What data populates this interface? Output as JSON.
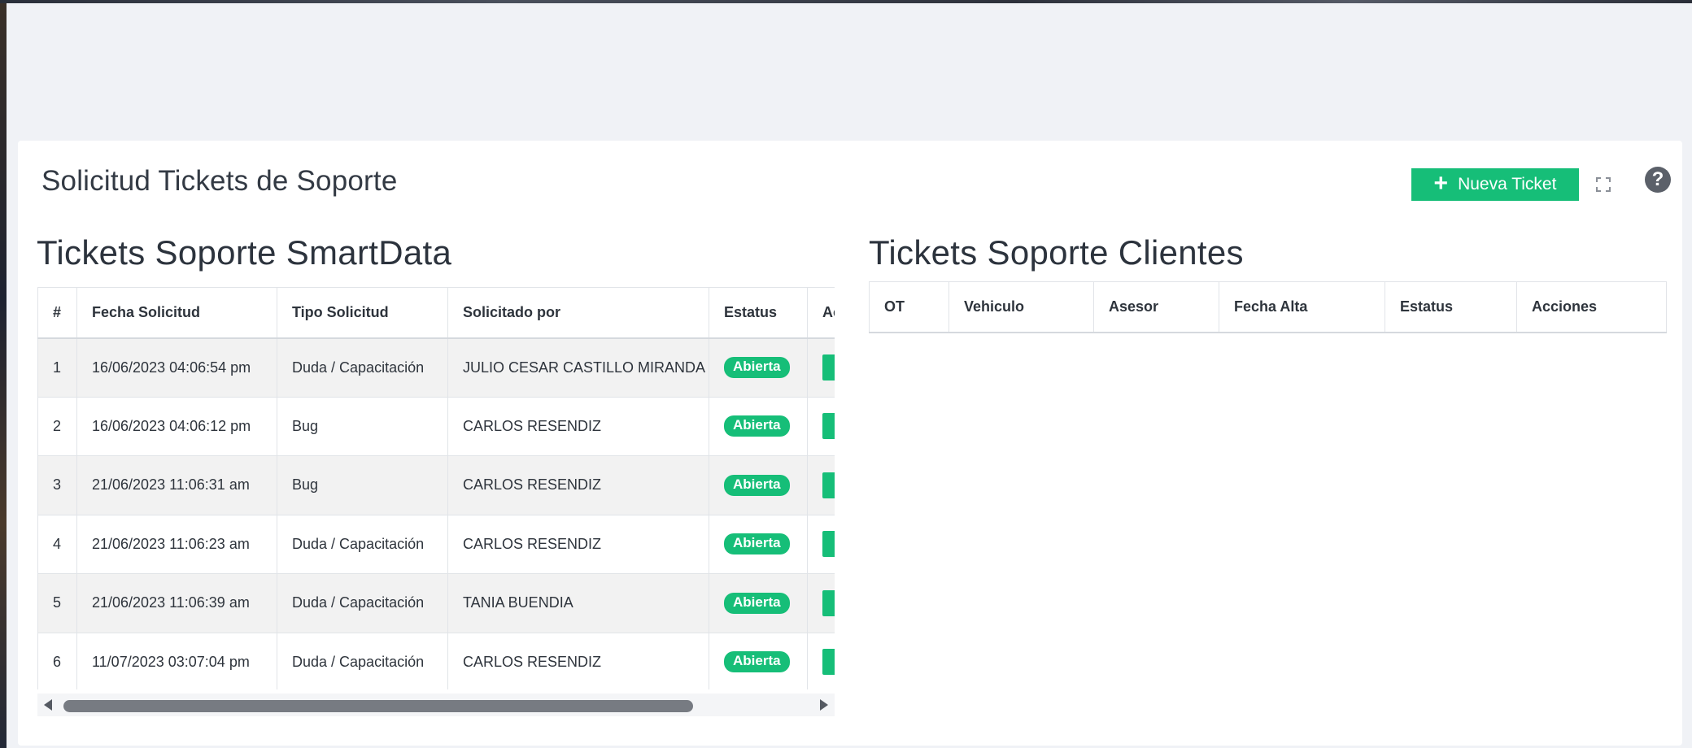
{
  "page": {
    "title": "Solicitud Tickets de Soporte",
    "new_button_label": "Nueva Ticket"
  },
  "smartdata": {
    "title": "Tickets Soporte SmartData",
    "columns": [
      "#",
      "Fecha Solicitud",
      "Tipo Solicitud",
      "Solicitado por",
      "Estatus",
      "Acciones"
    ],
    "rows": [
      {
        "num": "1",
        "fecha": "16/06/2023 04:06:54 pm",
        "tipo": "Duda / Capacitación",
        "solicitado": "JULIO CESAR CASTILLO MIRANDA",
        "estatus": "Abierta"
      },
      {
        "num": "2",
        "fecha": "16/06/2023 04:06:12 pm",
        "tipo": "Bug",
        "solicitado": "CARLOS RESENDIZ",
        "estatus": "Abierta"
      },
      {
        "num": "3",
        "fecha": "21/06/2023 11:06:31 am",
        "tipo": "Bug",
        "solicitado": "CARLOS RESENDIZ",
        "estatus": "Abierta"
      },
      {
        "num": "4",
        "fecha": "21/06/2023 11:06:23 am",
        "tipo": "Duda / Capacitación",
        "solicitado": "CARLOS RESENDIZ",
        "estatus": "Abierta"
      },
      {
        "num": "5",
        "fecha": "21/06/2023 11:06:39 am",
        "tipo": "Duda / Capacitación",
        "solicitado": "TANIA BUENDIA",
        "estatus": "Abierta"
      },
      {
        "num": "6",
        "fecha": "11/07/2023 03:07:04 pm",
        "tipo": "Duda / Capacitación",
        "solicitado": "CARLOS RESENDIZ",
        "estatus": "Abierta"
      }
    ]
  },
  "clientes": {
    "title": "Tickets Soporte Clientes",
    "columns": [
      "OT",
      "Vehiculo",
      "Asesor",
      "Fecha Alta",
      "Estatus",
      "Acciones"
    ]
  },
  "colors": {
    "accent": "#16be78",
    "background": "#f0f2f6"
  },
  "icons": {
    "add": "plus-icon",
    "expand": "expand-icon",
    "help": "question-circle-icon"
  }
}
